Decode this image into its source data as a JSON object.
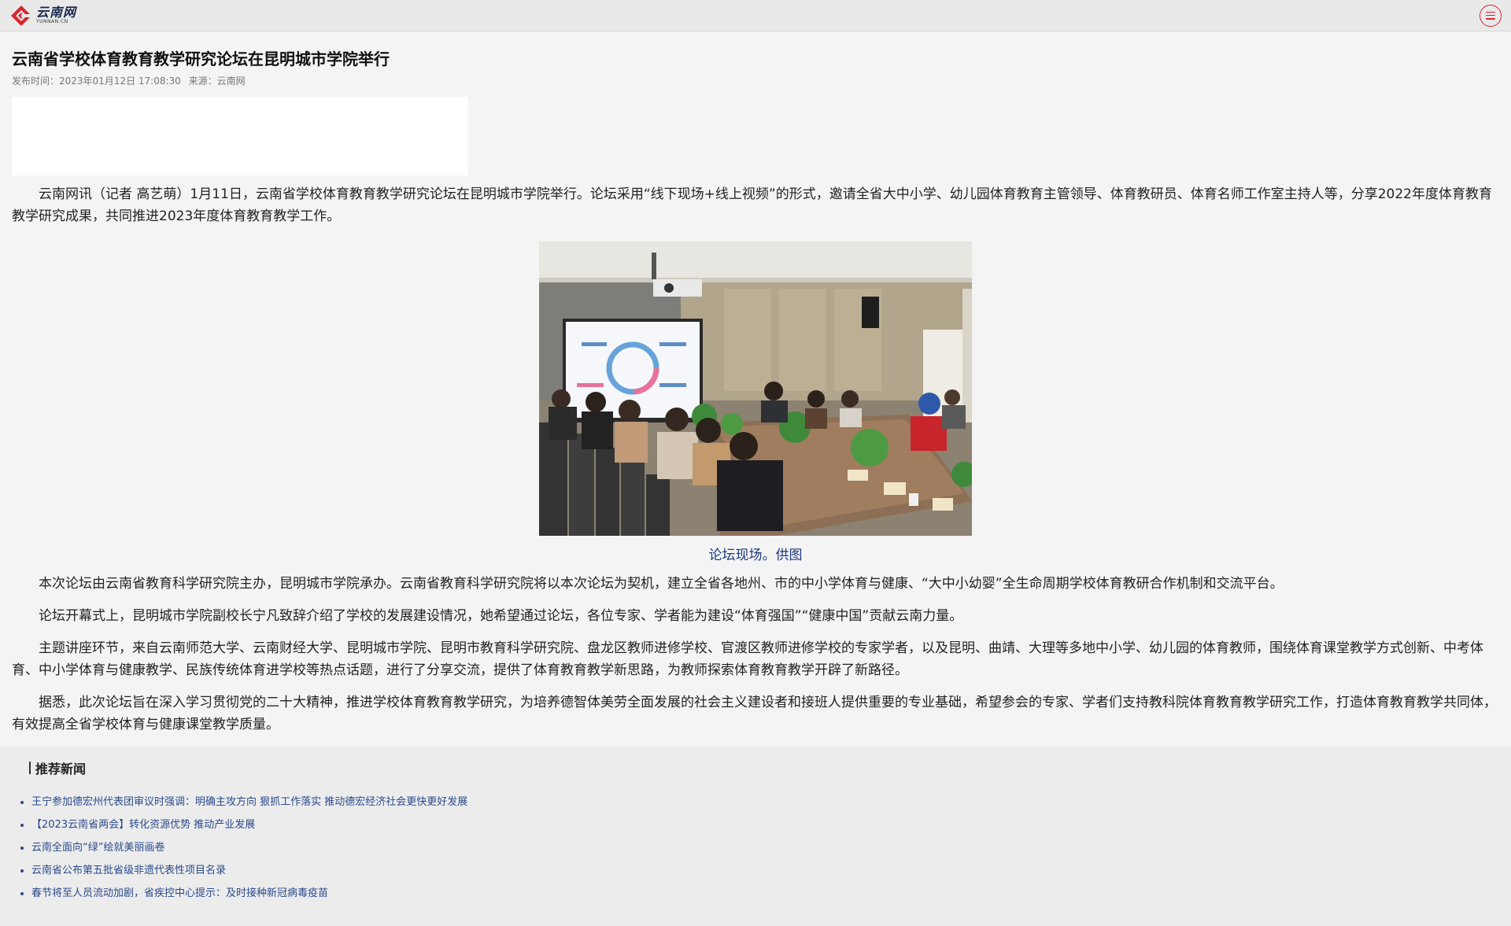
{
  "header": {
    "logo_text": "云南网",
    "logo_subtext": "YUNNAN.CN"
  },
  "article": {
    "title": "云南省学校体育教育教学研究论坛在昆明城市学院举行",
    "publish_time": "发布时间：2023年01月12日 17:08:30",
    "source": "来源：云南网",
    "paragraphs": [
      "云南网讯（记者 高艺萌）1月11日，云南省学校体育教育教学研究论坛在昆明城市学院举行。论坛采用“线下现场+线上视频”的形式，邀请全省大中小学、幼儿园体育教育主管领导、体育教研员、体育名师工作室主持人等，分享2022年度体育教育教学研究成果，共同推进2023年度体育教育教学工作。",
      "本次论坛由云南省教育科学研究院主办，昆明城市学院承办。云南省教育科学研究院将以本次论坛为契机，建立全省各地州、市的中小学体育与健康、“大中小幼婴”全生命周期学校体育教研合作机制和交流平台。",
      "论坛开幕式上，昆明城市学院副校长宁凡致辞介绍了学校的发展建设情况，她希望通过论坛，各位专家、学者能为建设“体育强国”“健康中国”贡献云南力量。",
      "主题讲座环节，来自云南师范大学、云南财经大学、昆明城市学院、昆明市教育科学研究院、盘龙区教师进修学校、官渡区教师进修学校的专家学者，以及昆明、曲靖、大理等多地中小学、幼儿园的体育教师，围绕体育课堂教学方式创新、中考体育、中小学体育与健康教学、民族传统体育进学校等热点话题，进行了分享交流，提供了体育教育教学新思路，为教师探索体育教育教学开辟了新路径。",
      "据悉，此次论坛旨在深入学习贯彻党的二十大精神，推进学校体育教育教学研究，为培养德智体美劳全面发展的社会主义建设者和接班人提供重要的专业基础，希望参会的专家、学者们支持教科院体育教育教学研究工作，打造体育教育教学共同体，有效提高全省学校体育与健康课堂教学质量。"
    ],
    "photo_caption": "论坛现场。供图"
  },
  "recommend": {
    "title": "推荐新闻",
    "items": [
      "王宁参加德宏州代表团审议时强调：明确主攻方向 狠抓工作落实 推动德宏经济社会更快更好发展",
      "【2023云南省两会】转化资源优势 推动产业发展",
      "云南全面向“绿”绘就美丽画卷",
      "云南省公布第五批省级非遗代表性项目名录",
      "春节将至人员流动加剧，省疾控中心提示：及时接种新冠病毒疫苗"
    ]
  },
  "colors": {
    "brand_red": "#d8262d",
    "link_blue": "#2a4a8a",
    "caption_blue": "#1a3a7a"
  },
  "icons": {
    "logo": "yunnan-net-logo",
    "menu": "menu-icon"
  }
}
